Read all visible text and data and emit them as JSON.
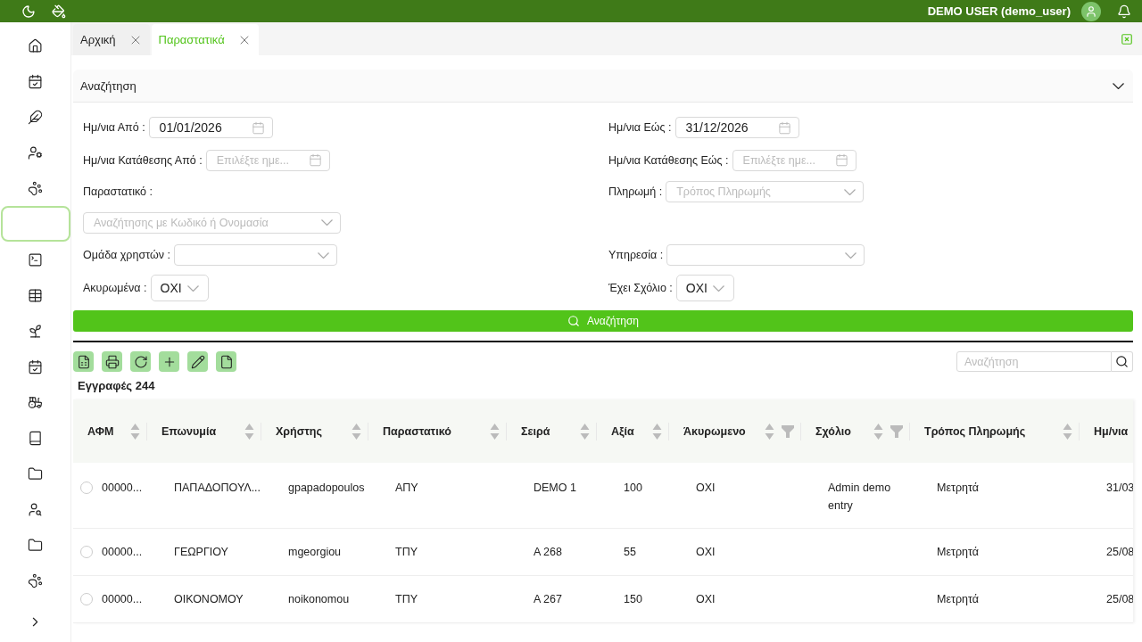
{
  "topbar": {
    "user": "DEMO USER (demo_user)"
  },
  "sidebar": {
    "items": [
      {
        "kind": "home",
        "selected": false
      },
      {
        "kind": "calendar",
        "selected": false
      },
      {
        "kind": "feather",
        "selected": false
      },
      {
        "kind": "user",
        "selected": false
      },
      {
        "kind": "paw",
        "selected": false
      },
      {
        "kind": "blank",
        "selected": true
      },
      {
        "kind": "terminal",
        "selected": false
      },
      {
        "kind": "table",
        "selected": false
      },
      {
        "kind": "sprout",
        "selected": false
      },
      {
        "kind": "calendar",
        "selected": false
      },
      {
        "kind": "tractor",
        "selected": false
      },
      {
        "kind": "book",
        "selected": false
      },
      {
        "kind": "folder",
        "selected": false
      },
      {
        "kind": "usersearch",
        "selected": false
      },
      {
        "kind": "folder",
        "selected": false
      },
      {
        "kind": "paw",
        "selected": false
      },
      {
        "kind": "expand",
        "selected": false
      }
    ]
  },
  "tabs": [
    {
      "label": "Αρχική",
      "selected": false
    },
    {
      "label": "Παραστατικά",
      "selected": true
    }
  ],
  "search_panel": {
    "title": "Αναζήτηση",
    "expanded": true,
    "rows": [
      [
        {
          "label": "Ημ/νια Από :",
          "kind": "date",
          "value": "01/01/2026"
        },
        {
          "label": "Ημ/νια Εώς :",
          "kind": "date",
          "value": "31/12/2026"
        }
      ],
      [
        {
          "label": "Ημ/νια Κατάθεσης Από :",
          "kind": "date",
          "placeholder": "Επιλέξτε ημε..."
        },
        {
          "label": "Ημ/νια Κατάθεσης Εώς :",
          "kind": "date",
          "placeholder": "Επιλέξτε ημε..."
        }
      ],
      [
        {
          "label": "Παραστατικό :",
          "kind": "label"
        },
        {
          "label": "Πληρωμή :",
          "kind": "select",
          "placeholder": "Τρόπος Πληρωμής"
        }
      ],
      [
        {
          "kind": "wideselect",
          "placeholder": "Αναζήτησης με Κωδικό ή Ονομασία"
        },
        {
          "kind": "none"
        }
      ],
      [
        {
          "label": "Ομάδα χρηστών :",
          "kind": "select"
        },
        {
          "label": "Υπηρεσία :",
          "kind": "select"
        }
      ],
      [
        {
          "label": "Ακυρωμένα :",
          "kind": "toggle",
          "value": "ΟΧΙ"
        },
        {
          "label": "Έχει Σχόλιο :",
          "kind": "toggle",
          "value": "ΟΧΙ"
        }
      ]
    ],
    "button": "Αναζήτηση"
  },
  "toolbar": [
    {
      "kind": "excel"
    },
    {
      "kind": "print"
    },
    {
      "kind": "refresh"
    },
    {
      "kind": "add"
    },
    {
      "kind": "edit"
    },
    {
      "kind": "file"
    }
  ],
  "records": "Εγγραφές 244",
  "grid_search": {
    "placeholder": "Αναζήτηση"
  },
  "table": {
    "columns": [
      {
        "label": "ΑΦΜ",
        "sortable": true,
        "filterable": false
      },
      {
        "label": "Επωνυμία",
        "sortable": true,
        "filterable": false
      },
      {
        "label": "Χρήστης",
        "sortable": true,
        "filterable": false
      },
      {
        "label": "Παραστατικό",
        "sortable": true,
        "filterable": false
      },
      {
        "label": "Σειρά",
        "sortable": true,
        "filterable": false
      },
      {
        "label": "Αξία",
        "sortable": true,
        "filterable": false
      },
      {
        "label": "Άκυρωμενο",
        "sortable": true,
        "filterable": true
      },
      {
        "label": "Σχόλιο",
        "sortable": true,
        "filterable": true
      },
      {
        "label": "Τρόπος Πληρωμής",
        "sortable": true,
        "filterable": false
      },
      {
        "label": "Ημ/νια",
        "sortable": false,
        "filterable": false
      }
    ],
    "rows": [
      {
        "selected": false,
        "cells": [
          "00000...",
          "ΠΑΠΑΔΟΠΟΥΛ...",
          "gpapadopoulos",
          "ΑΠΥ",
          "DEMO 1",
          "100",
          "ΟΧΙ",
          "Admin demo entry",
          "Μετρητά",
          "31/03"
        ]
      },
      {
        "selected": false,
        "cells": [
          "00000...",
          "ΓΕΩΡΓΙΟΥ",
          "mgeorgiou",
          "ΤΠΥ",
          "Α 268",
          "55",
          "ΟΧΙ",
          "",
          "Μετρητά",
          "25/08"
        ]
      },
      {
        "selected": false,
        "cells": [
          "00000...",
          "ΟΙΚΟΝΟΜΟΥ",
          "noikonomou",
          "ΤΠΥ",
          "Α 267",
          "150",
          "ΟΧΙ",
          "",
          "Μετρητά",
          "25/08"
        ]
      }
    ]
  }
}
